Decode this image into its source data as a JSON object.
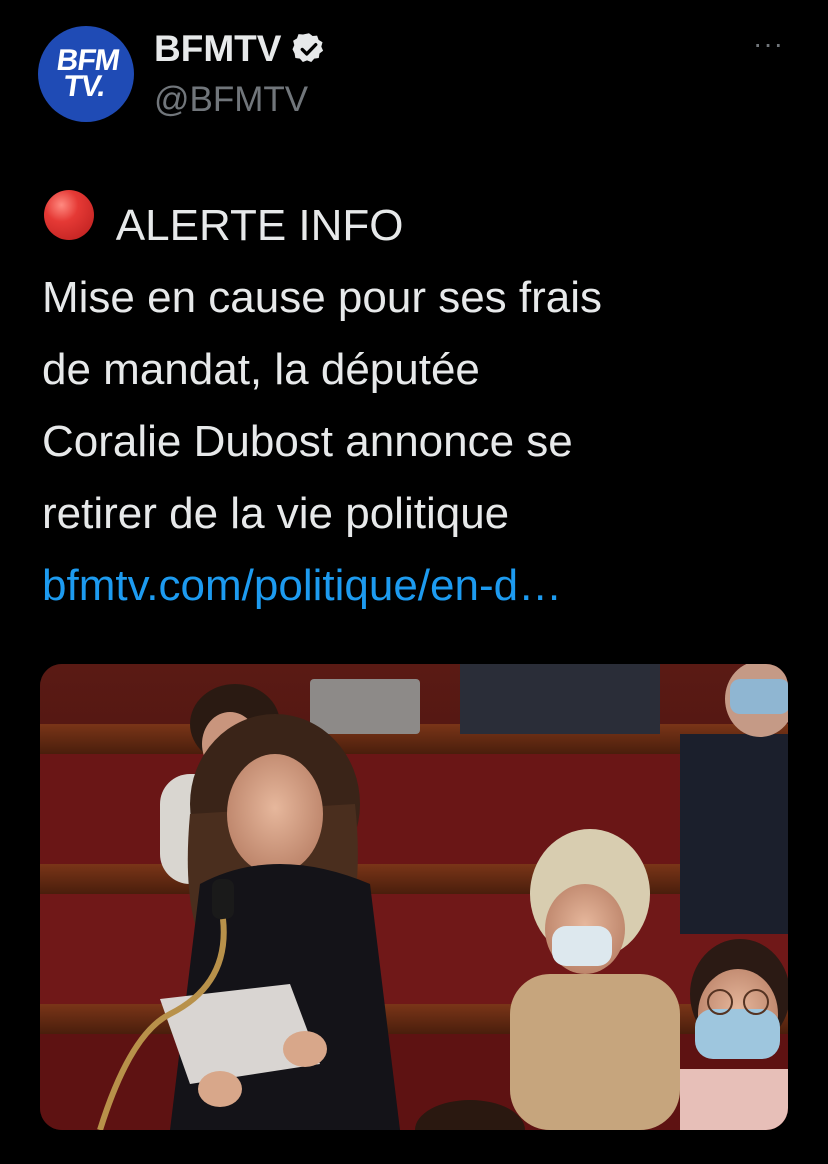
{
  "account": {
    "display_name": "BFMTV",
    "handle": "@BFMTV",
    "avatar_logo_top": "BFM",
    "avatar_logo_bottom": "TV."
  },
  "tweet": {
    "alert_label": "ALERTE INFO",
    "lines": [
      "Mise en cause pour ses frais",
      "de mandat, la députée",
      "Coralie Dubost annonce se",
      "retirer de la vie politique"
    ],
    "link_text": "bfmtv.com/politique/en-d…"
  },
  "menu": {
    "more_label": "···"
  },
  "icons": {
    "verified": "verified-badge-icon",
    "alert": "red-circle-icon",
    "more": "more-options-icon"
  },
  "colors": {
    "background": "#000000",
    "link": "#1d9bf0",
    "secondary": "#71767b",
    "text": "#e7e9ea",
    "avatar": "#1f4bb5"
  }
}
